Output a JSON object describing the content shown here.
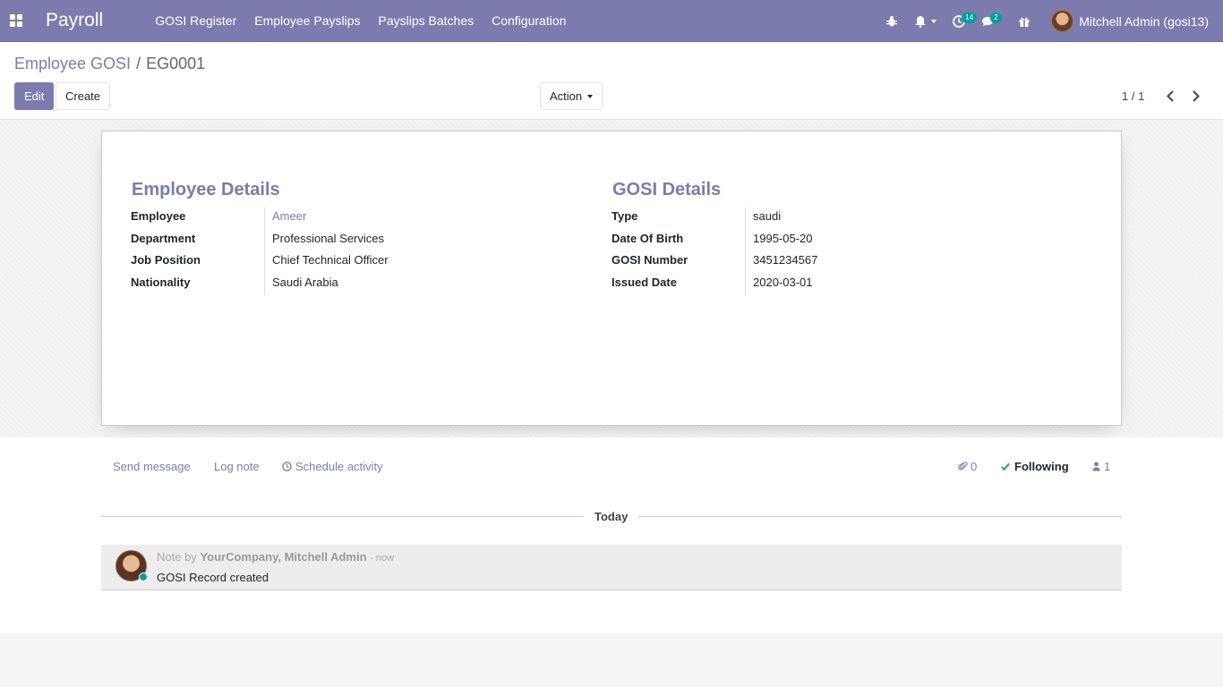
{
  "navbar": {
    "app_name": "Payroll",
    "menu": [
      "GOSI Register",
      "Employee Payslips",
      "Payslips Batches",
      "Configuration"
    ],
    "activity_count": "14",
    "message_count": "2",
    "user_name": "Mitchell Admin (gosi13)",
    "bg_color": "#7c7bad"
  },
  "control_panel": {
    "breadcrumb_parent": "Employee GOSI",
    "breadcrumb_sep": "/",
    "breadcrumb_current": "EG0001",
    "edit_label": "Edit",
    "create_label": "Create",
    "action_label": "Action",
    "pager_value": "1 / 1"
  },
  "employee_details": {
    "title": "Employee Details",
    "fields": [
      {
        "label": "Employee",
        "value": "Ameer"
      },
      {
        "label": "Department",
        "value": "Professional Services"
      },
      {
        "label": "Job Position",
        "value": "Chief Technical Officer"
      },
      {
        "label": "Nationality",
        "value": "Saudi Arabia"
      }
    ]
  },
  "gosi_details": {
    "title": "GOSI Details",
    "fields": [
      {
        "label": "Type",
        "value": "saudi"
      },
      {
        "label": "Date Of Birth",
        "value": "1995-05-20"
      },
      {
        "label": "GOSI Number",
        "value": "3451234567"
      },
      {
        "label": "Issued Date",
        "value": "2020-03-01"
      }
    ]
  },
  "chatter": {
    "send_message": "Send message",
    "log_note": "Log note",
    "schedule_activity": "Schedule activity",
    "attachments_count": "0",
    "following_label": "Following",
    "followers_count": "1",
    "today_label": "Today",
    "message": {
      "prefix": "Note by",
      "author": "YourCompany, Mitchell Admin",
      "date": "- now",
      "body": "GOSI Record created"
    }
  }
}
